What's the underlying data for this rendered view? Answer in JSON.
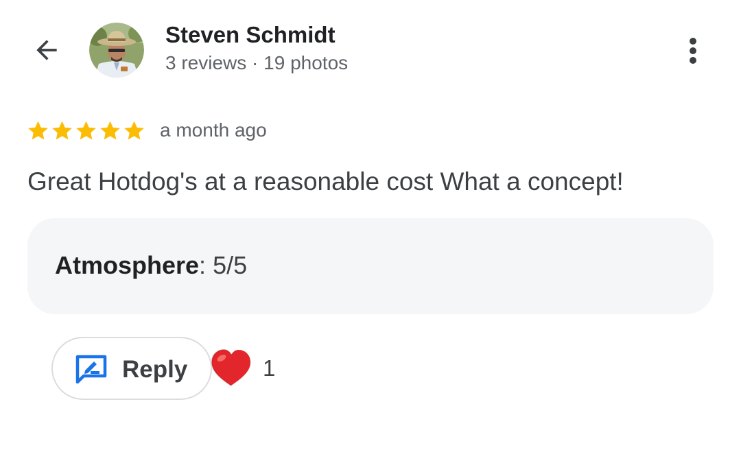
{
  "header": {
    "back_icon": "arrow-back-icon",
    "avatar_icon": "user-avatar",
    "user_name": "Steven Schmidt",
    "user_meta": "3 reviews · 19 photos",
    "more_icon": "more-vert-icon"
  },
  "review": {
    "rating": 5,
    "max_rating": 5,
    "star_color": "#fbbc04",
    "date": "a month ago",
    "text": "Great Hotdog's at a reasonable cost What a concept!",
    "attributes": {
      "key": "Atmosphere",
      "separator": ": ",
      "value": "5/5"
    }
  },
  "actions": {
    "reply_label": "Reply",
    "reply_icon": "reply-edit-icon",
    "reply_icon_color": "#1a73e8",
    "reaction_icon": "red-heart-icon",
    "reaction_count": "1"
  }
}
